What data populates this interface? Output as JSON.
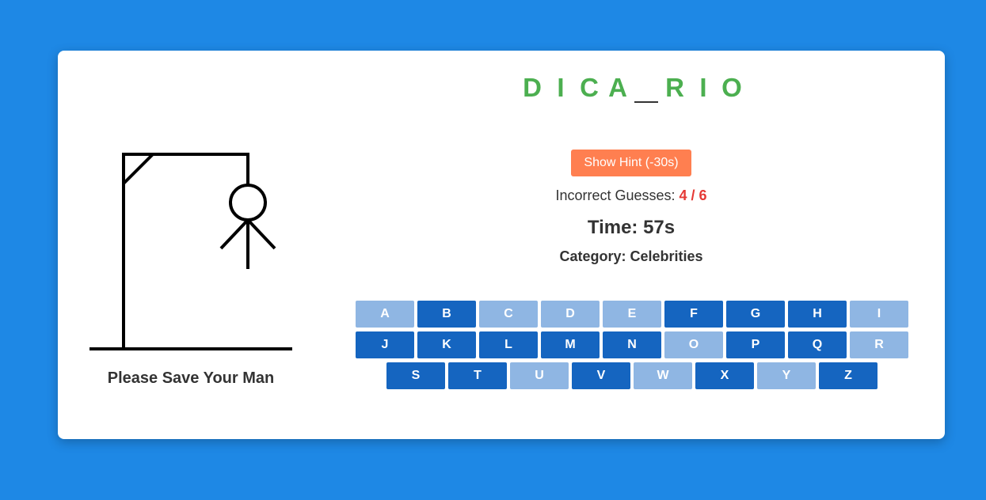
{
  "word": {
    "slots": [
      "D",
      "I",
      "C",
      "A",
      "",
      "R",
      "I",
      "O"
    ]
  },
  "hint_button": {
    "label": "Show Hint (-30s)"
  },
  "guesses": {
    "label": "Incorrect Guesses: ",
    "count": "4 / 6"
  },
  "timer": {
    "text": "Time: 57s"
  },
  "category": {
    "text": "Category: Celebrities"
  },
  "caption": {
    "text": "Please Save Your Man"
  },
  "colors": {
    "background": "#1e88e5",
    "word": "#4caf50",
    "hint": "#ff7f50",
    "incorrect": "#e53935",
    "key_active": "#1565c0",
    "key_used": "#8fb6e3"
  },
  "keyboard": {
    "rows": [
      [
        {
          "letter": "A",
          "state": "used"
        },
        {
          "letter": "B",
          "state": "active"
        },
        {
          "letter": "C",
          "state": "used"
        },
        {
          "letter": "D",
          "state": "used"
        },
        {
          "letter": "E",
          "state": "used"
        },
        {
          "letter": "F",
          "state": "active"
        },
        {
          "letter": "G",
          "state": "active"
        },
        {
          "letter": "H",
          "state": "active"
        },
        {
          "letter": "I",
          "state": "used"
        }
      ],
      [
        {
          "letter": "J",
          "state": "active"
        },
        {
          "letter": "K",
          "state": "active"
        },
        {
          "letter": "L",
          "state": "active"
        },
        {
          "letter": "M",
          "state": "active"
        },
        {
          "letter": "N",
          "state": "active"
        },
        {
          "letter": "O",
          "state": "used"
        },
        {
          "letter": "P",
          "state": "active"
        },
        {
          "letter": "Q",
          "state": "active"
        },
        {
          "letter": "R",
          "state": "used"
        }
      ],
      [
        {
          "letter": "S",
          "state": "active"
        },
        {
          "letter": "T",
          "state": "active"
        },
        {
          "letter": "U",
          "state": "used"
        },
        {
          "letter": "V",
          "state": "active"
        },
        {
          "letter": "W",
          "state": "used"
        },
        {
          "letter": "X",
          "state": "active"
        },
        {
          "letter": "Y",
          "state": "used"
        },
        {
          "letter": "Z",
          "state": "active"
        }
      ]
    ]
  },
  "hangman": {
    "wrong_guesses": 4,
    "max_guesses": 6,
    "parts_visible": [
      "head",
      "body",
      "left-arm",
      "right-arm"
    ]
  }
}
